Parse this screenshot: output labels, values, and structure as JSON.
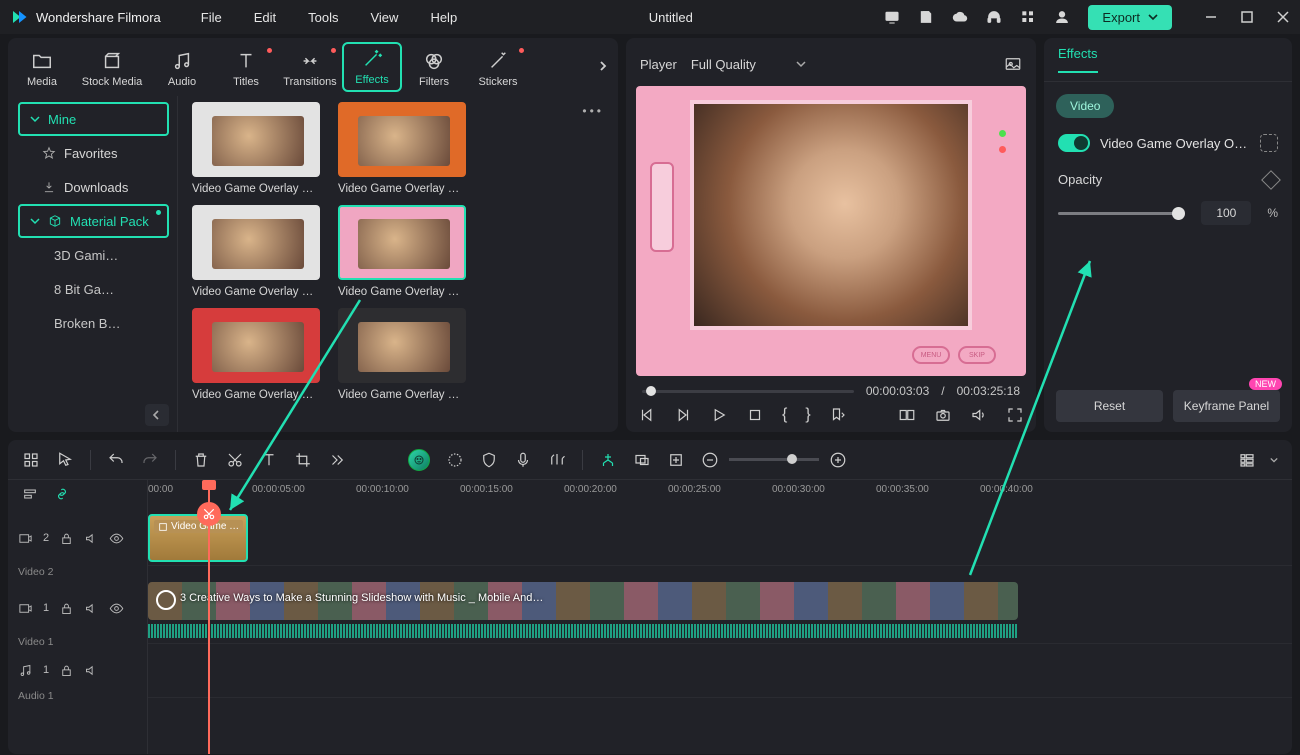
{
  "app": {
    "name": "Wondershare Filmora",
    "document": "Untitled"
  },
  "menu": [
    "File",
    "Edit",
    "Tools",
    "View",
    "Help"
  ],
  "export_label": "Export",
  "library": {
    "tabs": [
      {
        "id": "media",
        "label": "Media"
      },
      {
        "id": "stock",
        "label": "Stock Media"
      },
      {
        "id": "audio",
        "label": "Audio"
      },
      {
        "id": "titles",
        "label": "Titles",
        "dot": true
      },
      {
        "id": "transitions",
        "label": "Transitions",
        "dot": true
      },
      {
        "id": "effects",
        "label": "Effects",
        "active": true
      },
      {
        "id": "filters",
        "label": "Filters"
      },
      {
        "id": "stickers",
        "label": "Stickers",
        "dot": true
      }
    ],
    "sidebar": {
      "mine": "Mine",
      "favorites": "Favorites",
      "downloads": "Downloads",
      "material_pack": "Material Pack",
      "subs": [
        "3D Gami…",
        "8 Bit Ga…",
        "Broken B…"
      ]
    },
    "items": [
      {
        "label": "Video Game Overlay …",
        "style": "white"
      },
      {
        "label": "Video Game Overlay …",
        "style": "gb"
      },
      {
        "label": ""
      },
      {
        "label": "Video Game Overlay …",
        "style": "white"
      },
      {
        "label": "Video Game Overlay …",
        "style": "pink",
        "selected": true
      },
      {
        "label": ""
      },
      {
        "label": "Video Game Overlay …",
        "style": "switch"
      },
      {
        "label": "Video Game Overlay …",
        "style": "dark"
      }
    ]
  },
  "player": {
    "label": "Player",
    "quality": "Full Quality",
    "console_buttons": [
      "MENU",
      "SKIP"
    ],
    "current": "00:00:03:03",
    "sep": "/",
    "duration": "00:03:25:18"
  },
  "fx": {
    "tab": "Effects",
    "category": "Video",
    "item_name": "Video Game Overlay O…",
    "opacity_label": "Opacity",
    "opacity_value": "100",
    "opacity_unit": "%",
    "reset": "Reset",
    "keyframe": "Keyframe Panel",
    "new": "NEW"
  },
  "timeline": {
    "ruler": [
      "00:00",
      "00:00:05:00",
      "00:00:10:00",
      "00:00:15:00",
      "00:00:20:00",
      "00:00:25:00",
      "00:00:30:00",
      "00:00:35:00",
      "00:00:40:00"
    ],
    "tracks": {
      "v2": {
        "icon": "video",
        "index": "2",
        "label": "Video 2"
      },
      "v1": {
        "icon": "video",
        "index": "1",
        "label": "Video 1"
      },
      "a1": {
        "icon": "audio",
        "index": "1",
        "label": "Audio 1"
      }
    },
    "clip_v2_label": "Video Game …",
    "clip_v1_label": "3 Creative Ways to Make a Stunning Slideshow with Music _ Mobile And…"
  }
}
